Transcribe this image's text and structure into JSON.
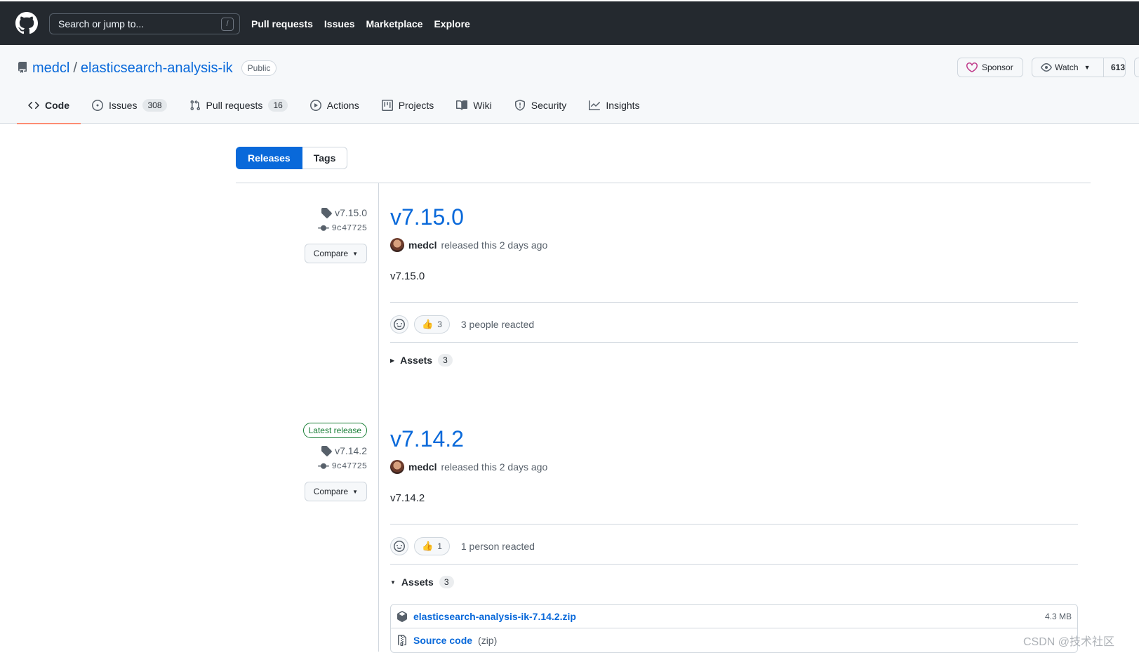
{
  "header": {
    "search_placeholder": "Search or jump to...",
    "search_shortcut": "/",
    "nav": [
      "Pull requests",
      "Issues",
      "Marketplace",
      "Explore"
    ]
  },
  "repo": {
    "owner": "medcl",
    "name": "elasticsearch-analysis-ik",
    "visibility": "Public",
    "sponsor_label": "Sponsor",
    "watch_label": "Watch",
    "watch_count": "613"
  },
  "tabs": [
    {
      "label": "Code",
      "icon": "code-icon"
    },
    {
      "label": "Issues",
      "count": "308",
      "icon": "issue-icon"
    },
    {
      "label": "Pull requests",
      "count": "16",
      "icon": "pull-request-icon"
    },
    {
      "label": "Actions",
      "icon": "play-icon"
    },
    {
      "label": "Projects",
      "icon": "project-icon"
    },
    {
      "label": "Wiki",
      "icon": "book-icon"
    },
    {
      "label": "Security",
      "icon": "shield-icon"
    },
    {
      "label": "Insights",
      "icon": "graph-icon"
    }
  ],
  "subnav": {
    "releases": "Releases",
    "tags": "Tags"
  },
  "releases": [
    {
      "tag": "v7.15.0",
      "commit": "9c47725",
      "compare": "Compare",
      "title": "v7.15.0",
      "author": "medcl",
      "released": "released this 2 days ago",
      "body": "v7.15.0",
      "thumbs": "3",
      "reacted": "3 people reacted",
      "assets_label": "Assets",
      "assets_count": "3"
    },
    {
      "latest": "Latest release",
      "tag": "v7.14.2",
      "commit": "9c47725",
      "compare": "Compare",
      "title": "v7.14.2",
      "author": "medcl",
      "released": "released this 2 days ago",
      "body": "v7.14.2",
      "thumbs": "1",
      "reacted": "1 person reacted",
      "assets_label": "Assets",
      "assets_count": "3",
      "assets": [
        {
          "name": "elasticsearch-analysis-ik-7.14.2.zip",
          "size": "4.3 MB",
          "icon": "package-icon"
        },
        {
          "name": "Source code",
          "suffix": "(zip)",
          "icon": "file-zip-icon"
        }
      ]
    }
  ],
  "watermark": "CSDN @技术社区",
  "colors": {
    "link": "#0969da",
    "header_bg": "#24292f",
    "tab_underline": "#fd8c73",
    "latest_green": "#1a7f37"
  }
}
